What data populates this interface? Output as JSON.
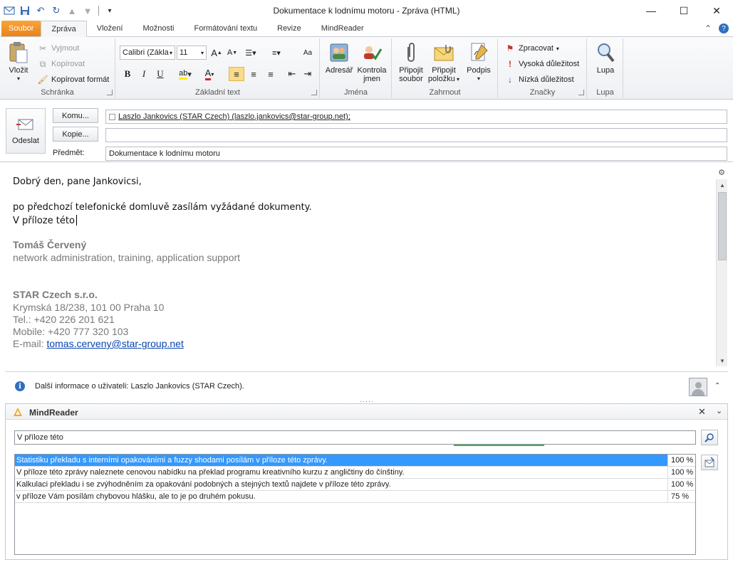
{
  "window": {
    "title": "Dokumentace k lodnímu motoru  -  Zpráva (HTML)"
  },
  "tabs": [
    {
      "label": "Soubor"
    },
    {
      "label": "Zpráva"
    },
    {
      "label": "Vložení"
    },
    {
      "label": "Možnosti"
    },
    {
      "label": "Formátování textu"
    },
    {
      "label": "Revize"
    },
    {
      "label": "MindReader"
    }
  ],
  "ribbon": {
    "clipboard": {
      "label": "Schránka",
      "paste": "Vložit",
      "cut": "Vyjmout",
      "copy": "Kopírovat",
      "format_painter": "Kopírovat formát"
    },
    "basic_text": {
      "label": "Základní text",
      "font": "Calibri (Zákla",
      "size": "11",
      "bold": "B",
      "italic": "I",
      "underline": "U"
    },
    "names": {
      "label": "Jména",
      "address_book": "Adresář",
      "check_names_1": "Kontrola",
      "check_names_2": "jmen"
    },
    "include": {
      "label": "Zahrnout",
      "attach_file_1": "Připojit",
      "attach_file_2": "soubor",
      "attach_item_1": "Připojit",
      "attach_item_2": "položku",
      "signature": "Podpis"
    },
    "tags": {
      "label": "Značky",
      "follow_up": "Zpracovat",
      "high_importance": "Vysoká důležitost",
      "low_importance": "Nízká důležitost"
    },
    "zoom": {
      "label": "Lupa",
      "zoom": "Lupa"
    }
  },
  "header": {
    "send": "Odeslat",
    "to_button": "Komu...",
    "cc_button": "Kopie...",
    "subject_label": "Předmět:",
    "to_value": "Laszlo Jankovics (STAR Czech) (laszlo.jankovics@star-group.net);",
    "cc_value": "",
    "subject_value": "Dokumentace k lodnímu motoru"
  },
  "body": {
    "greeting": "Dobrý den, pane Jankovicsi,",
    "line1": "po předchozí telefonické domluvě zasílám vyžádané dokumenty.",
    "line2": "V příloze této",
    "sig_name": "Tomáš Červený",
    "sig_role": "network administration, training, application support",
    "company": "STAR Czech s.r.o.",
    "address": "Krymská 18/238, 101 00 Praha 10",
    "tel": "Tel.: +420 226 201 621",
    "mobile": "Mobile: +420 777 320 103",
    "email_label": "E-mail: ",
    "email": "tomas.cerveny@star-group.net"
  },
  "infobar": {
    "text": "Další informace o uživateli: Laszlo Jankovics (STAR Czech)."
  },
  "mindreader": {
    "title": "MindReader",
    "query": "V příloze této",
    "results": [
      {
        "text": "Statistiku překladu s interními opakováními a fuzzy shodami posílám v příloze této zprávy.",
        "score": "100 %"
      },
      {
        "text": "V příloze této zprávy naleznete cenovou nabídku na překlad programu kreativního kurzu z angličtiny do čínštiny.",
        "score": "100 %"
      },
      {
        "text": "Kalkulaci překladu i se zvýhodněním za opakování podobných a stejných textů najdete v příloze této zprávy.",
        "score": "100 %"
      },
      {
        "text": "v příloze Vám posílám chybovou hlášku, ale to je po druhém pokusu.",
        "score": "75 %"
      }
    ]
  },
  "colors": {
    "file_tab": "#e8831a",
    "selection": "#3399ff",
    "link": "#0645ad",
    "signature_gray": "#7a7a7a"
  }
}
